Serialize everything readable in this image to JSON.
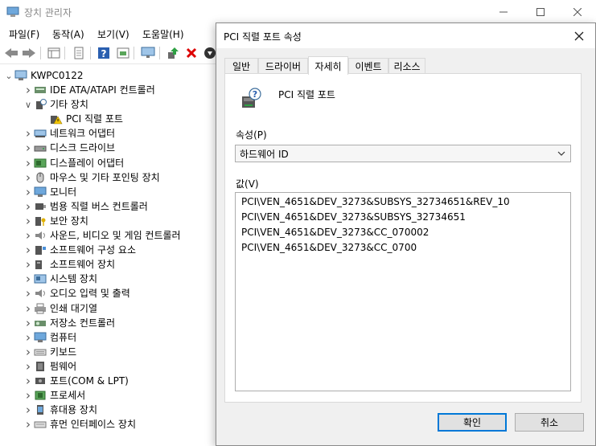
{
  "window": {
    "title": "장치 관리자",
    "menu": [
      "파일(F)",
      "동작(A)",
      "보기(V)",
      "도움말(H)"
    ]
  },
  "toolbar": {
    "icons": [
      "back-arrow-icon",
      "forward-arrow-icon",
      "properties-grid-icon",
      "document-icon",
      "help-icon",
      "driver-icon",
      "monitor-scan-icon",
      "update-driver-icon",
      "uninstall-icon",
      "download-icon"
    ]
  },
  "tree": {
    "root": "KWPC0122",
    "items": [
      {
        "label": "IDE ATA/ATAPI 컨트롤러",
        "icon": "ide-controller-icon",
        "expanded": false
      },
      {
        "label": "기타 장치",
        "icon": "other-devices-icon",
        "expanded": true
      },
      {
        "label": "PCI 직렬 포트",
        "icon": "warning-device-icon",
        "child": true
      },
      {
        "label": "네트워크 어댑터",
        "icon": "network-adapter-icon",
        "expanded": false
      },
      {
        "label": "디스크 드라이브",
        "icon": "disk-drive-icon",
        "expanded": false
      },
      {
        "label": "디스플레이 어댑터",
        "icon": "display-adapter-icon",
        "expanded": false
      },
      {
        "label": "마우스 및 기타 포인팅 장치",
        "icon": "mouse-icon",
        "expanded": false
      },
      {
        "label": "모니터",
        "icon": "monitor-icon",
        "expanded": false
      },
      {
        "label": "범용 직렬 버스 컨트롤러",
        "icon": "usb-controller-icon",
        "expanded": false
      },
      {
        "label": "보안 장치",
        "icon": "security-device-icon",
        "expanded": false
      },
      {
        "label": "사운드, 비디오 및 게임 컨트롤러",
        "icon": "speaker-icon",
        "expanded": false
      },
      {
        "label": "소프트웨어 구성 요소",
        "icon": "software-component-icon",
        "expanded": false
      },
      {
        "label": "소프트웨어 장치",
        "icon": "software-device-icon",
        "expanded": false
      },
      {
        "label": "시스템 장치",
        "icon": "system-device-icon",
        "expanded": false
      },
      {
        "label": "오디오 입력 및 출력",
        "icon": "audio-io-icon",
        "expanded": false
      },
      {
        "label": "인쇄 대기열",
        "icon": "printer-icon",
        "expanded": false
      },
      {
        "label": "저장소 컨트롤러",
        "icon": "storage-controller-icon",
        "expanded": false
      },
      {
        "label": "컴퓨터",
        "icon": "computer-icon",
        "expanded": false
      },
      {
        "label": "키보드",
        "icon": "keyboard-icon",
        "expanded": false
      },
      {
        "label": "펌웨어",
        "icon": "firmware-icon",
        "expanded": false
      },
      {
        "label": "포트(COM & LPT)",
        "icon": "port-icon",
        "expanded": false
      },
      {
        "label": "프로세서",
        "icon": "processor-icon",
        "expanded": false
      },
      {
        "label": "휴대용 장치",
        "icon": "portable-device-icon",
        "expanded": false
      },
      {
        "label": "휴먼 인터페이스 장치",
        "icon": "hid-icon",
        "expanded": false
      }
    ]
  },
  "dialog": {
    "title": "PCI 직렬 포트 속성",
    "tabs": [
      "일반",
      "드라이버",
      "자세히",
      "이벤트",
      "리소스"
    ],
    "active_tab": "자세히",
    "device_name": "PCI 직렬 포트",
    "property_label": "속성(P)",
    "property_value": "하드웨어 ID",
    "value_label": "값(V)",
    "values": [
      "PCI\\VEN_4651&DEV_3273&SUBSYS_32734651&REV_10",
      "PCI\\VEN_4651&DEV_3273&SUBSYS_32734651",
      "PCI\\VEN_4651&DEV_3273&CC_070002",
      "PCI\\VEN_4651&DEV_3273&CC_0700"
    ],
    "ok_label": "확인",
    "cancel_label": "취소"
  },
  "colors": {
    "accent": "#0078d7",
    "warning": "#f2c500",
    "dialog_bg": "#f0f0f0"
  }
}
